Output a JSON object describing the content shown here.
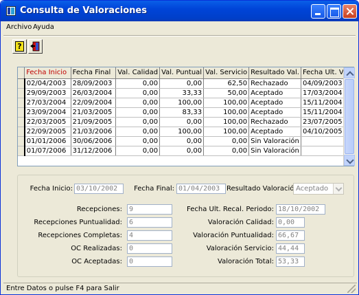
{
  "window": {
    "title": "Consulta de Valoraciones"
  },
  "menu": [
    "Archivo",
    "Ayuda"
  ],
  "toolbar": {
    "help_glyph": "?",
    "help_icon": "help-icon",
    "exit_icon": "exit-door-icon"
  },
  "grid": {
    "columns": [
      "Fecha Inicio",
      "Fecha Final",
      "Val. Calidad",
      "Val. Puntual",
      "Val. Servicio",
      "Resultado Val.",
      "Fecha Ult. Val."
    ],
    "rows": [
      [
        "02/04/2003",
        "28/09/2003",
        "0,00",
        "0,00",
        "62,50",
        "Rechazado",
        "04/09/2003"
      ],
      [
        "29/09/2003",
        "26/03/2004",
        "0,00",
        "33,33",
        "50,00",
        "Aceptado",
        "17/03/2004"
      ],
      [
        "27/03/2004",
        "22/09/2004",
        "0,00",
        "100,00",
        "100,00",
        "Aceptado",
        "15/11/2004"
      ],
      [
        "23/09/2004",
        "21/03/2005",
        "0,00",
        "83,33",
        "100,00",
        "Aceptado",
        "15/11/2004"
      ],
      [
        "22/03/2005",
        "21/09/2005",
        "0,00",
        "0,00",
        "100,00",
        "Rechazado",
        "23/07/2005"
      ],
      [
        "22/09/2005",
        "21/03/2006",
        "0,00",
        "100,00",
        "100,00",
        "Aceptado",
        "04/10/2005"
      ],
      [
        "01/01/2006",
        "30/06/2006",
        "0,00",
        "0,00",
        "0,00",
        "Sin Valoración",
        ""
      ],
      [
        "01/07/2006",
        "31/12/2006",
        "0,00",
        "0,00",
        "0,00",
        "Sin Valoración",
        ""
      ]
    ]
  },
  "detail": {
    "fecha_inicio_label": "Fecha Inicio:",
    "fecha_inicio": "03/10/2002",
    "fecha_final_label": "Fecha Final:",
    "fecha_final": "01/04/2003",
    "resultado_label": "Resultado Valoración:",
    "resultado": "Aceptado",
    "recepciones_label": "Recepciones:",
    "recepciones": "9",
    "recepciones_puntualidad_label": "Recepciones Puntualidad:",
    "recepciones_puntualidad": "6",
    "recepciones_completas_label": "Recepciones Completas:",
    "recepciones_completas": "4",
    "oc_realizadas_label": "OC Realizadas:",
    "oc_realizadas": "0",
    "oc_aceptadas_label": "OC Aceptadas:",
    "oc_aceptadas": "0",
    "fecha_ult_recal_label": "Fecha Ult. Recal. Periodo:",
    "fecha_ult_recal": "18/10/2002",
    "valoracion_calidad_label": "Valoración Calidad:",
    "valoracion_calidad": "0,00",
    "valoracion_puntualidad_label": "Valoración Puntualidad:",
    "valoracion_puntualidad": "66,67",
    "valoracion_servicio_label": "Valoración Servicio:",
    "valoracion_servicio": "44,44",
    "valoracion_total_label": "Valoración Total:",
    "valoracion_total": "53,33"
  },
  "status": {
    "text": "Entre Datos o pulse F4 para Salir"
  },
  "colors": {
    "titlebar": "#0044d8",
    "sorted_header": "#c00000",
    "window_bg": "#ece9d8"
  }
}
